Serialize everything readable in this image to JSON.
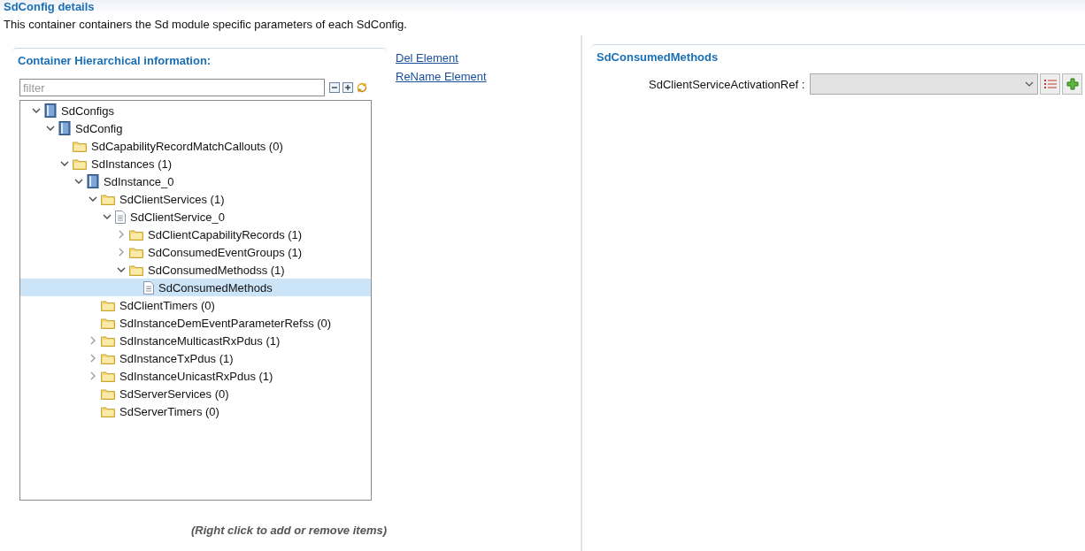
{
  "page": {
    "title": "SdConfig details",
    "description": "This container containers the Sd module specific parameters of each SdConfig."
  },
  "hierarchy": {
    "title": "Container Hierarchical information:",
    "filter": {
      "placeholder": "filter"
    },
    "tree": [
      {
        "label": "SdConfigs",
        "kind": "config",
        "expanded": true,
        "selected": false,
        "children": [
          {
            "label": "SdConfig",
            "kind": "config",
            "expanded": true,
            "selected": false,
            "children": [
              {
                "label": "SdCapabilityRecordMatchCallouts (0)",
                "kind": "folder",
                "selected": false
              },
              {
                "label": "SdInstances (1)",
                "kind": "folder",
                "expanded": true,
                "selected": false,
                "children": [
                  {
                    "label": "SdInstance_0",
                    "kind": "config",
                    "expanded": true,
                    "selected": false,
                    "children": [
                      {
                        "label": "SdClientServices (1)",
                        "kind": "folder",
                        "expanded": true,
                        "selected": false,
                        "children": [
                          {
                            "label": "SdClientService_0",
                            "kind": "file",
                            "expanded": true,
                            "selected": false,
                            "children": [
                              {
                                "label": "SdClientCapabilityRecords (1)",
                                "kind": "folder",
                                "expanded": false,
                                "selected": false
                              },
                              {
                                "label": "SdConsumedEventGroups (1)",
                                "kind": "folder",
                                "expanded": false,
                                "selected": false
                              },
                              {
                                "label": "SdConsumedMethodss (1)",
                                "kind": "folder",
                                "expanded": true,
                                "selected": false,
                                "children": [
                                  {
                                    "label": "SdConsumedMethods",
                                    "kind": "file",
                                    "selected": true
                                  }
                                ]
                              }
                            ]
                          }
                        ]
                      },
                      {
                        "label": "SdClientTimers (0)",
                        "kind": "folder",
                        "selected": false
                      },
                      {
                        "label": "SdInstanceDemEventParameterRefss (0)",
                        "kind": "folder",
                        "selected": false
                      },
                      {
                        "label": "SdInstanceMulticastRxPdus (1)",
                        "kind": "folder",
                        "expanded": false,
                        "selected": false
                      },
                      {
                        "label": "SdInstanceTxPdus (1)",
                        "kind": "folder",
                        "expanded": false,
                        "selected": false
                      },
                      {
                        "label": "SdInstanceUnicastRxPdus (1)",
                        "kind": "folder",
                        "expanded": false,
                        "selected": false
                      },
                      {
                        "label": "SdServerServices (0)",
                        "kind": "folder",
                        "selected": false
                      },
                      {
                        "label": "SdServerTimers (0)",
                        "kind": "folder",
                        "selected": false
                      }
                    ]
                  }
                ]
              }
            ]
          }
        ]
      }
    ],
    "hint": "(Right click to add or remove items)"
  },
  "links": [
    "Del Element",
    "ReName Element"
  ],
  "detail": {
    "title": "SdConsumedMethods",
    "fields": [
      {
        "label": "SdClientServiceActivationRef :"
      }
    ]
  }
}
